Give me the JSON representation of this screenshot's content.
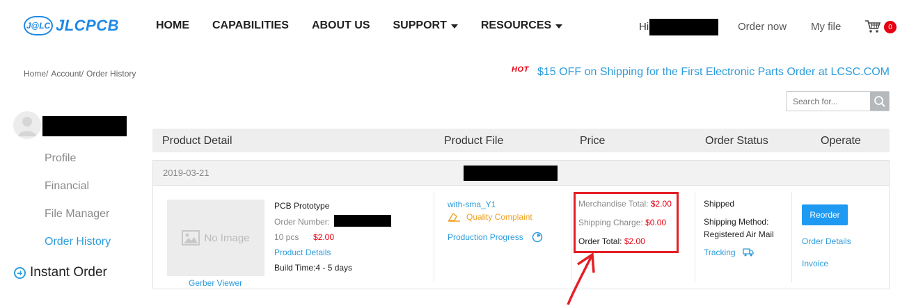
{
  "header": {
    "logo_badge": "J@LC",
    "logo_text": "JLCPCB",
    "nav": [
      "HOME",
      "CAPABILITIES",
      "ABOUT US",
      "SUPPORT",
      "RESOURCES"
    ],
    "greeting": "Hi",
    "order_now": "Order now",
    "my_file": "My file",
    "cart_count": "0"
  },
  "breadcrumb": [
    "Home/",
    "Account/",
    "Order History"
  ],
  "promo": {
    "hot": "HOT",
    "text": "$15 OFF on Shipping for the First Electronic Parts Order at LCSC.COM"
  },
  "search": {
    "placeholder": "Search for..."
  },
  "sidebar": {
    "items": [
      "Profile",
      "Financial",
      "File Manager",
      "Order History"
    ],
    "active": "Order History",
    "instant_order": "Instant Order"
  },
  "table": {
    "headers": [
      "Product Detail",
      "Product File",
      "Price",
      "Order Status",
      "Operate"
    ]
  },
  "order": {
    "date": "2019-03-21",
    "no_image": "No Image",
    "gerber_viewer": "Gerber Viewer",
    "product_name": "PCB Prototype",
    "order_number_label": "Order Number:",
    "quantity": "10 pcs",
    "unit_price": "$2.00",
    "product_details": "Product Details",
    "build_time_label": "Build Time:",
    "build_time": "4 - 5 days",
    "file_name": "with-sma_Y1",
    "quality_complaint": "Quality Complaint",
    "production_progress": "Production Progress",
    "merchandise_label": "Merchandise Total:",
    "merchandise_value": "$2.00",
    "shipping_label": "Shipping Charge:",
    "shipping_value": "$0.00",
    "total_label": "Order Total:",
    "total_value": "$2.00",
    "status": "Shipped",
    "shipping_method_label": "Shipping Method:",
    "shipping_method": "Registered Air Mail",
    "tracking": "Tracking",
    "reorder": "Reorder",
    "order_details": "Order Details",
    "invoice": "Invoice"
  },
  "colors": {
    "brand_blue": "#1e88e5",
    "link_blue": "#2d9cdb",
    "price_red": "#e60012",
    "annotation_red": "#e41f26"
  }
}
